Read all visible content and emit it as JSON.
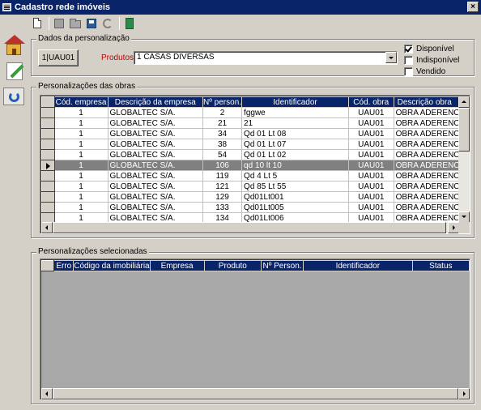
{
  "window": {
    "title": "Cadastro rede imóveis",
    "close_label": "×"
  },
  "toolbar": {
    "buttons": [
      "new-icon",
      "edit-icon",
      "open-icon",
      "save-icon",
      "refresh-icon",
      "exit-icon"
    ]
  },
  "sidebar": {
    "items": [
      "house-icon",
      "pencil-icon",
      "sync-icon"
    ]
  },
  "personalizacao": {
    "legend": "Dados da personalização",
    "code_button": "1|UAU01",
    "produtos_label": "Produtos:",
    "produtos_value": "1  CASAS DIVERSAS",
    "checks": [
      {
        "label": "Disponível",
        "checked": true
      },
      {
        "label": "Indisponível",
        "checked": false
      },
      {
        "label": "Vendido",
        "checked": false
      }
    ]
  },
  "obras": {
    "legend": "Personalizações das obras",
    "columns": [
      "Cód. empresa",
      "Descrição da empresa",
      "Nº person.",
      "Identificador",
      "Cód. obra",
      "Descrição obra"
    ],
    "rows": [
      [
        "1",
        "GLOBALTEC S/A.",
        "2",
        "fggwe",
        "UAU01",
        "OBRA ADERENCIA"
      ],
      [
        "1",
        "GLOBALTEC S/A.",
        "21",
        "21",
        "UAU01",
        "OBRA ADERENCIA"
      ],
      [
        "1",
        "GLOBALTEC S/A.",
        "34",
        "Qd 01 Lt 08",
        "UAU01",
        "OBRA ADERENCIA"
      ],
      [
        "1",
        "GLOBALTEC S/A.",
        "38",
        "Qd 01 Lt 07",
        "UAU01",
        "OBRA ADERENCIA"
      ],
      [
        "1",
        "GLOBALTEC S/A.",
        "54",
        "Qd 01 Lt 02",
        "UAU01",
        "OBRA ADERENCIA"
      ],
      [
        "1",
        "GLOBALTEC S/A.",
        "106",
        "qd 10 lt 10",
        "UAU01",
        "OBRA ADERENCIA"
      ],
      [
        "1",
        "GLOBALTEC S/A.",
        "119",
        "Qd 4 Lt 5",
        "UAU01",
        "OBRA ADERENCIA"
      ],
      [
        "1",
        "GLOBALTEC S/A.",
        "121",
        "Qd 85 Lt 55",
        "UAU01",
        "OBRA ADERENCIA"
      ],
      [
        "1",
        "GLOBALTEC S/A.",
        "129",
        "Qd01Lt001",
        "UAU01",
        "OBRA ADERENCIA"
      ],
      [
        "1",
        "GLOBALTEC S/A.",
        "133",
        "Qd01Lt005",
        "UAU01",
        "OBRA ADERENCIA"
      ],
      [
        "1",
        "GLOBALTEC S/A.",
        "134",
        "Qd01Lt006",
        "UAU01",
        "OBRA ADERENCIA"
      ]
    ],
    "selected_row": 5
  },
  "selecionadas": {
    "legend": "Personalizações selecionadas",
    "columns": [
      "Erro",
      "Código da imobiliária",
      "Empresa",
      "Produto",
      "Nº Person.",
      "Identificador",
      "Status"
    ]
  }
}
